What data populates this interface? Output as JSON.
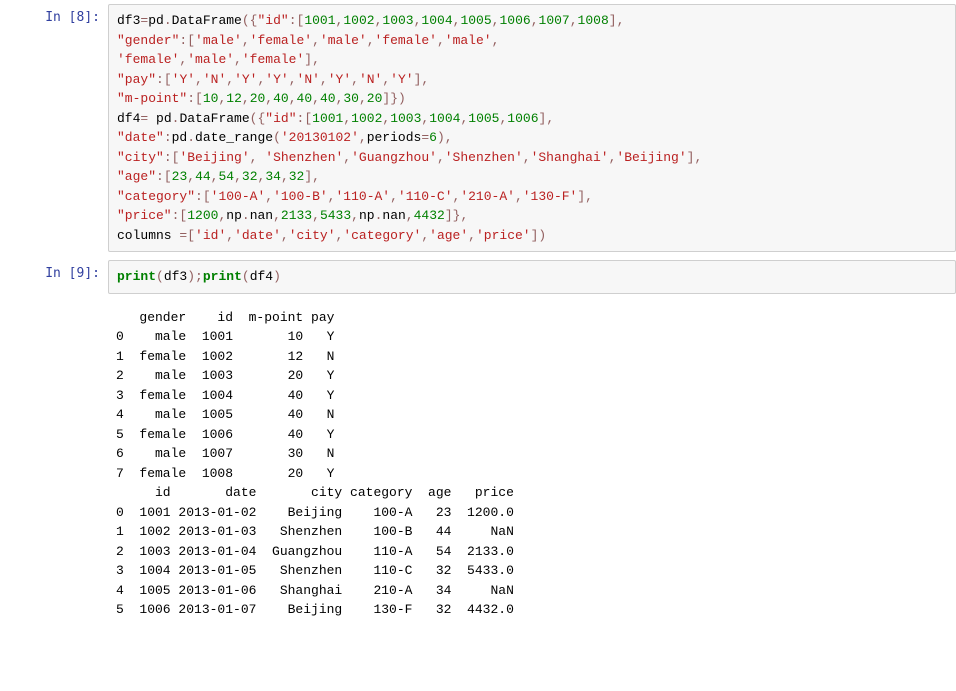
{
  "cells": {
    "c8": {
      "prompt": "In [8]:"
    },
    "c9": {
      "prompt": "In [9]:"
    }
  },
  "code_tokens": {
    "df3": "df3",
    "df4": "df4",
    "pd": "pd",
    "np": "np",
    "DataFrame": "DataFrame",
    "date_range": "date_range",
    "nan": "nan",
    "print": "print",
    "columns": "columns",
    "periods": "periods",
    "eq": "=",
    "dot": ".",
    "lp": "(",
    "rp": ")",
    "lb": "[",
    "rb": "]",
    "lc": "{",
    "rc": "}",
    "comma": ",",
    "colon": ":",
    "semi": ";",
    "sp": " "
  },
  "strings": {
    "id": "\"id\"",
    "gender": "\"gender\"",
    "pay": "\"pay\"",
    "mpoint": "\"m-point\"",
    "date": "\"date\"",
    "city": "\"city\"",
    "age": "\"age\"",
    "category": "\"category\"",
    "price": "\"price\"",
    "male": "'male'",
    "female": "'female'",
    "Y": "'Y'",
    "N": "'N'",
    "d20130102": "'20130102'",
    "Beijing": "'Beijing'",
    "Shenzhen": "'Shenzhen'",
    "Guangzhou": "'Guangzhou'",
    "Shanghai": "'Shanghai'",
    "c100A": "'100-A'",
    "c100B": "'100-B'",
    "c110A": "'110-A'",
    "c110C": "'110-C'",
    "c210A": "'210-A'",
    "c130F": "'130-F'",
    "col_id": "'id'",
    "col_date": "'date'",
    "col_city": "'city'",
    "col_category": "'category'",
    "col_age": "'age'",
    "col_price": "'price'"
  },
  "numbers": {
    "n1001": "1001",
    "n1002": "1002",
    "n1003": "1003",
    "n1004": "1004",
    "n1005": "1005",
    "n1006": "1006",
    "n1007": "1007",
    "n1008": "1008",
    "n10": "10",
    "n12": "12",
    "n20": "20",
    "n30": "30",
    "n40": "40",
    "n23": "23",
    "n44": "44",
    "n54": "54",
    "n32": "32",
    "n34": "34",
    "n1200": "1200",
    "n2133": "2133",
    "n5433": "5433",
    "n4432": "4432",
    "n6": "6"
  },
  "output_text": "   gender    id  m-point pay\n0    male  1001       10   Y\n1  female  1002       12   N\n2    male  1003       20   Y\n3  female  1004       40   Y\n4    male  1005       40   N\n5  female  1006       40   Y\n6    male  1007       30   N\n7  female  1008       20   Y\n     id       date       city category  age   price\n0  1001 2013-01-02    Beijing    100-A   23  1200.0\n1  1002 2013-01-03   Shenzhen    100-B   44     NaN\n2  1003 2013-01-04  Guangzhou    110-A   54  2133.0\n3  1004 2013-01-05   Shenzhen    110-C   32  5433.0\n4  1005 2013-01-06   Shanghai    210-A   34     NaN\n5  1006 2013-01-07    Beijing    130-F   32  4432.0",
  "chart_data": {
    "type": "table",
    "tables": [
      {
        "name": "df3",
        "columns": [
          "gender",
          "id",
          "m-point",
          "pay"
        ],
        "rows": [
          [
            "male",
            1001,
            10,
            "Y"
          ],
          [
            "female",
            1002,
            12,
            "N"
          ],
          [
            "male",
            1003,
            20,
            "Y"
          ],
          [
            "female",
            1004,
            40,
            "Y"
          ],
          [
            "male",
            1005,
            40,
            "N"
          ],
          [
            "female",
            1006,
            40,
            "Y"
          ],
          [
            "male",
            1007,
            30,
            "N"
          ],
          [
            "female",
            1008,
            20,
            "Y"
          ]
        ]
      },
      {
        "name": "df4",
        "columns": [
          "id",
          "date",
          "city",
          "category",
          "age",
          "price"
        ],
        "rows": [
          [
            1001,
            "2013-01-02",
            "Beijing",
            "100-A",
            23,
            1200.0
          ],
          [
            1002,
            "2013-01-03",
            "Shenzhen",
            "100-B",
            44,
            null
          ],
          [
            1003,
            "2013-01-04",
            "Guangzhou",
            "110-A",
            54,
            2133.0
          ],
          [
            1004,
            "2013-01-05",
            "Shenzhen",
            "110-C",
            32,
            5433.0
          ],
          [
            1005,
            "2013-01-06",
            "Shanghai",
            "210-A",
            34,
            null
          ],
          [
            1006,
            "2013-01-07",
            "Beijing",
            "130-F",
            32,
            4432.0
          ]
        ]
      }
    ]
  }
}
